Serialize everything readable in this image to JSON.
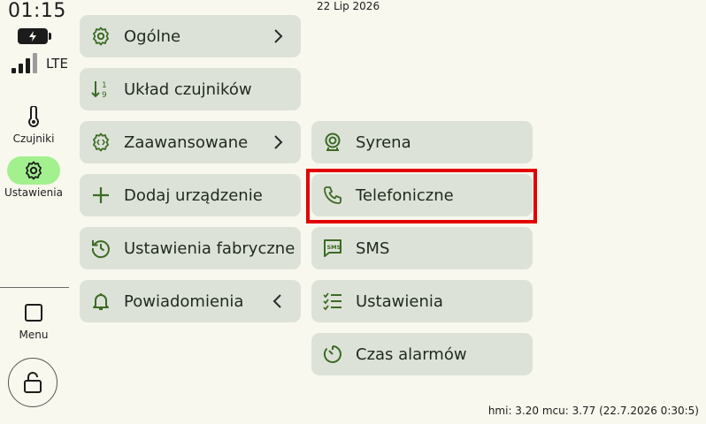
{
  "status": {
    "time": "01:15",
    "network": "LTE",
    "date": "22 Lip 2026",
    "version": "hmi: 3.20 mcu: 3.77 (22.7.2026 0:30:5)"
  },
  "sidebar": {
    "items": [
      {
        "label": "Czujniki",
        "icon": "thermometer-icon"
      },
      {
        "label": "Ustawienia",
        "icon": "gear-icon",
        "active": true
      },
      {
        "label": "Menu",
        "icon": "square-icon"
      }
    ],
    "lock_icon": "unlock-icon"
  },
  "menu_left": [
    {
      "label": "Ogólne",
      "icon": "gear-icon",
      "chevron": "right"
    },
    {
      "label": "Układ czujników",
      "icon": "sort-icon"
    },
    {
      "label": "Zaawansowane",
      "icon": "code-gear-icon",
      "chevron": "right"
    },
    {
      "label": "Dodaj urządzenie",
      "icon": "plus-icon"
    },
    {
      "label": "Ustawienia fabryczne",
      "icon": "history-icon"
    },
    {
      "label": "Powiadomienia",
      "icon": "bell-icon",
      "chevron": "left"
    }
  ],
  "menu_right": [
    {
      "label": "Syrena",
      "icon": "siren-icon"
    },
    {
      "label": "Telefoniczne",
      "icon": "phone-icon",
      "highlighted": true
    },
    {
      "label": "SMS",
      "icon": "sms-icon"
    },
    {
      "label": "Ustawienia",
      "icon": "checklist-icon"
    },
    {
      "label": "Czas alarmów",
      "icon": "timer-icon"
    }
  ],
  "colors": {
    "background": "#f8f8ee",
    "button": "#dde2d8",
    "icon_green": "#3b6b24",
    "active_pill": "#a3f08f",
    "highlight": "#e30000"
  }
}
